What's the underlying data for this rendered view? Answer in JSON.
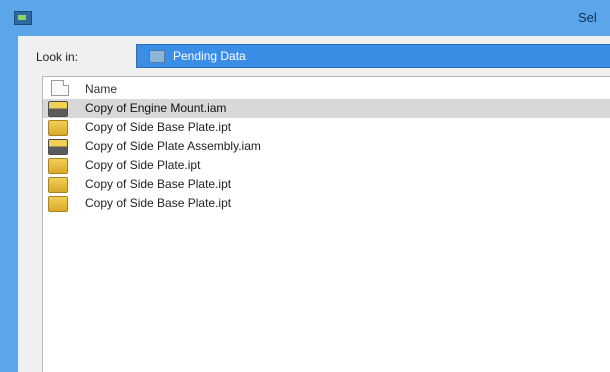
{
  "window": {
    "title": "Sel"
  },
  "lookin": {
    "label": "Look in:",
    "value": "Pending Data",
    "icon": "folder-icon"
  },
  "filelist": {
    "header": {
      "label": "Name",
      "icon": "document-icon"
    },
    "files": [
      {
        "name": "Copy of Engine Mount.iam",
        "type": "iam",
        "selected": true
      },
      {
        "name": "Copy of Side Base Plate.ipt",
        "type": "ipt",
        "selected": false
      },
      {
        "name": "Copy of Side Plate Assembly.iam",
        "type": "iam",
        "selected": false
      },
      {
        "name": "Copy of Side Plate.ipt",
        "type": "ipt",
        "selected": false
      },
      {
        "name": "Copy of Side Base Plate.ipt",
        "type": "ipt",
        "selected": false
      },
      {
        "name": "Copy of Side Base Plate.ipt",
        "type": "ipt",
        "selected": false
      }
    ]
  },
  "colors": {
    "titlebar": "#5aa6e8",
    "combo": "#3a8ee6",
    "selection": "#d8d8d8"
  }
}
